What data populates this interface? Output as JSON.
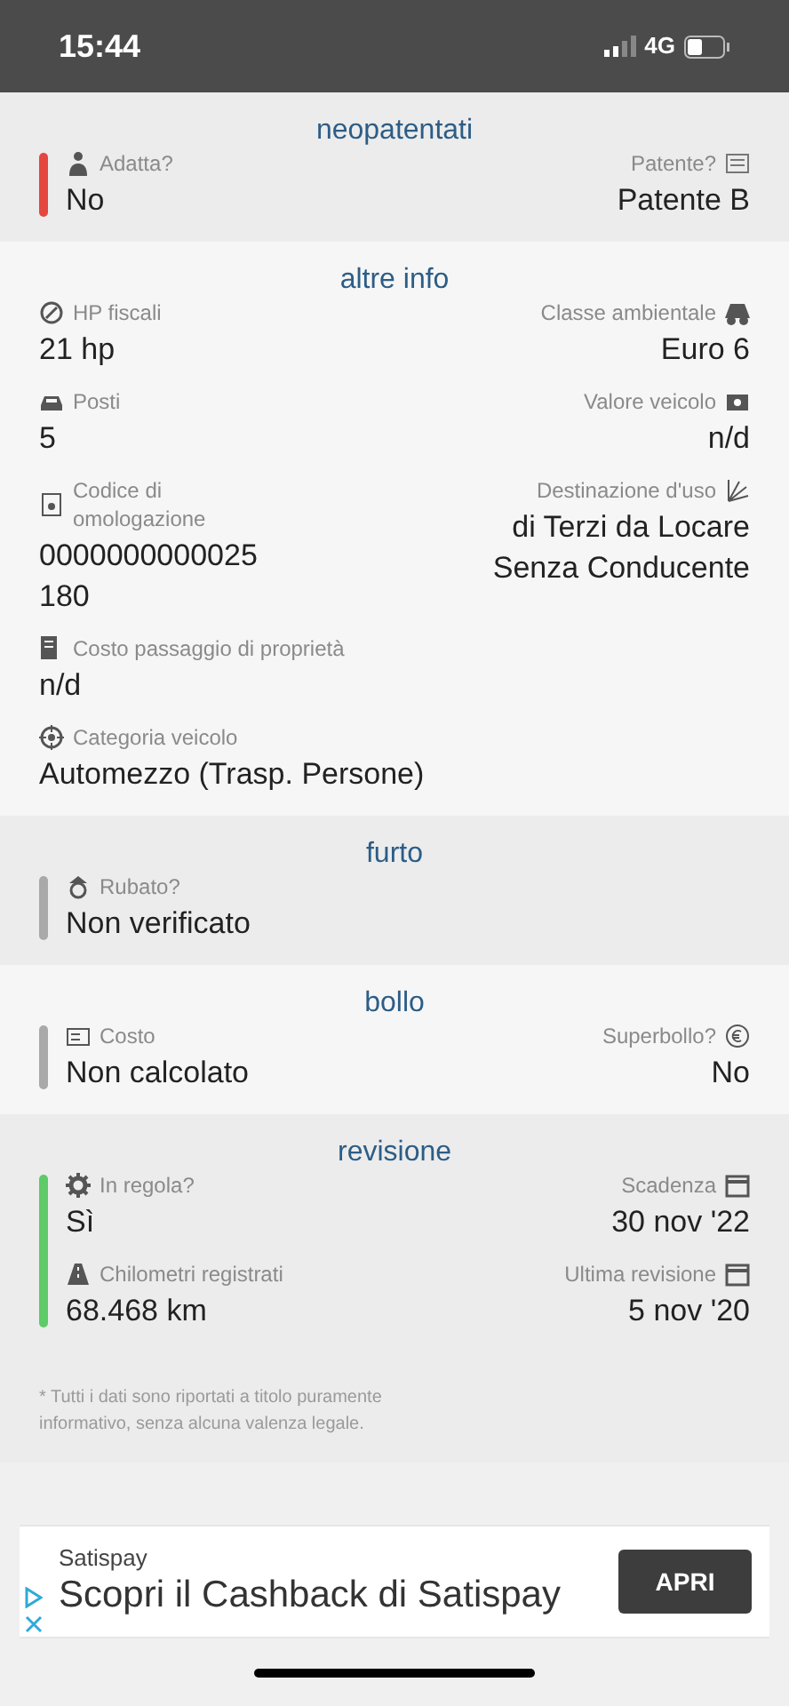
{
  "status_bar": {
    "time": "15:44",
    "network": "4G"
  },
  "sections": [
    {
      "title": "neopatentati",
      "color": "#e5463f",
      "rows": [
        {
          "left": {
            "label": "Adatta?",
            "value": "No"
          },
          "right": {
            "label": "Patente?",
            "value": "Patente B"
          }
        }
      ]
    },
    {
      "title": "altre info",
      "rows": [
        {
          "left": {
            "label": "HP fiscali",
            "value": "21 hp"
          },
          "right": {
            "label": "Classe ambientale",
            "value": "Euro 6"
          }
        },
        {
          "left": {
            "label": "Posti",
            "value": "5"
          },
          "right": {
            "label": "Valore veicolo",
            "value": "n/d"
          }
        },
        {
          "left": {
            "label": "Codice di omologazione",
            "value": [
              "0000000000025",
              "180"
            ]
          },
          "right": {
            "label": "Destinazione d'uso",
            "value": [
              "di Terzi da Locare",
              "Senza Conducente"
            ]
          }
        },
        {
          "left": {
            "label": "Costo passaggio di proprietà",
            "value": "n/d"
          }
        },
        {
          "left": {
            "label": "Categoria veicolo",
            "value": "Automezzo (Trasp. Persone)"
          }
        }
      ]
    },
    {
      "title": "furto",
      "color": "#a9a9a9",
      "rows": [
        {
          "left": {
            "label": "Rubato?",
            "value": "Non verificato"
          }
        }
      ]
    },
    {
      "title": "bollo",
      "color": "#a9a9a9",
      "rows": [
        {
          "left": {
            "label": "Costo",
            "value": "Non calcolato"
          },
          "right": {
            "label": "Superbollo?",
            "value": "No"
          }
        }
      ]
    },
    {
      "title": "revisione",
      "color": "#5dcb68",
      "rows": [
        {
          "left": {
            "label": "In regola?",
            "value": "Sì"
          },
          "right": {
            "label": "Scadenza",
            "value": "30 nov '22"
          }
        },
        {
          "left": {
            "label": "Chilometri registrati",
            "value": "68.468 km"
          },
          "right": {
            "label": "Ultima revisione",
            "value": "5 nov '20"
          }
        }
      ]
    }
  ],
  "disclaimer": "* Tutti i dati sono riportati a titolo puramente informativo, senza alcuna valenza legale.",
  "ad": {
    "advertiser": "Satispay",
    "headline": "Scopri il Cashback di Satispay",
    "button": "APRI"
  }
}
